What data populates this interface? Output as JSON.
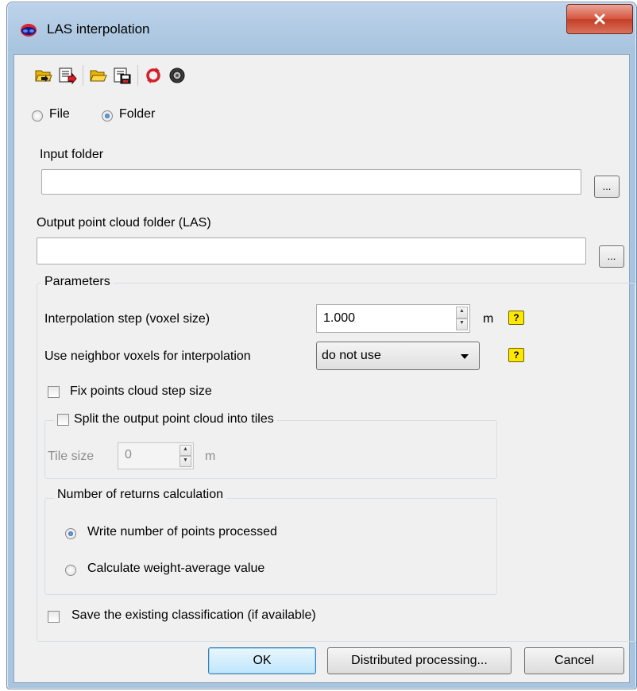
{
  "window": {
    "title": "LAS interpolation",
    "close_label": "x"
  },
  "toolbar": {
    "icons": [
      "load-settings-icon",
      "save-settings-icon",
      "open-folder-icon",
      "save-icon",
      "refresh-icon",
      "settings-wheel-icon"
    ]
  },
  "source": {
    "file_label": "File",
    "folder_label": "Folder",
    "selected": "Folder"
  },
  "input": {
    "label": "Input folder",
    "value": "",
    "browse_label": "..."
  },
  "output": {
    "label": "Output point cloud folder (LAS)",
    "value": "",
    "browse_label": "..."
  },
  "parameters": {
    "title": "Parameters",
    "step_label": "Interpolation step (voxel size)",
    "step_value": "1.000",
    "step_unit": "m",
    "help_label": "?",
    "neighbor_label": "Use neighbor voxels for interpolation",
    "neighbor_value": "do not use",
    "fix_step_label": "Fix points cloud step size",
    "fix_step_checked": false,
    "tiles": {
      "split_label": "Split the output point cloud into tiles",
      "split_checked": false,
      "tile_size_label": "Tile size",
      "tile_size_value": "0",
      "tile_size_unit": "m"
    },
    "returns": {
      "title": "Number of returns calculation",
      "option1": "Write number of points processed",
      "option2": "Calculate weight-average value",
      "selected": "option1"
    },
    "save_class_label": "Save the existing classification (if available)",
    "save_class_checked": false
  },
  "buttons": {
    "ok": "OK",
    "distributed": "Distributed processing...",
    "cancel": "Cancel"
  },
  "colors": {
    "help_icon": "#ffe800",
    "titlebar": "#a9c4df",
    "close": "#c33d24"
  }
}
